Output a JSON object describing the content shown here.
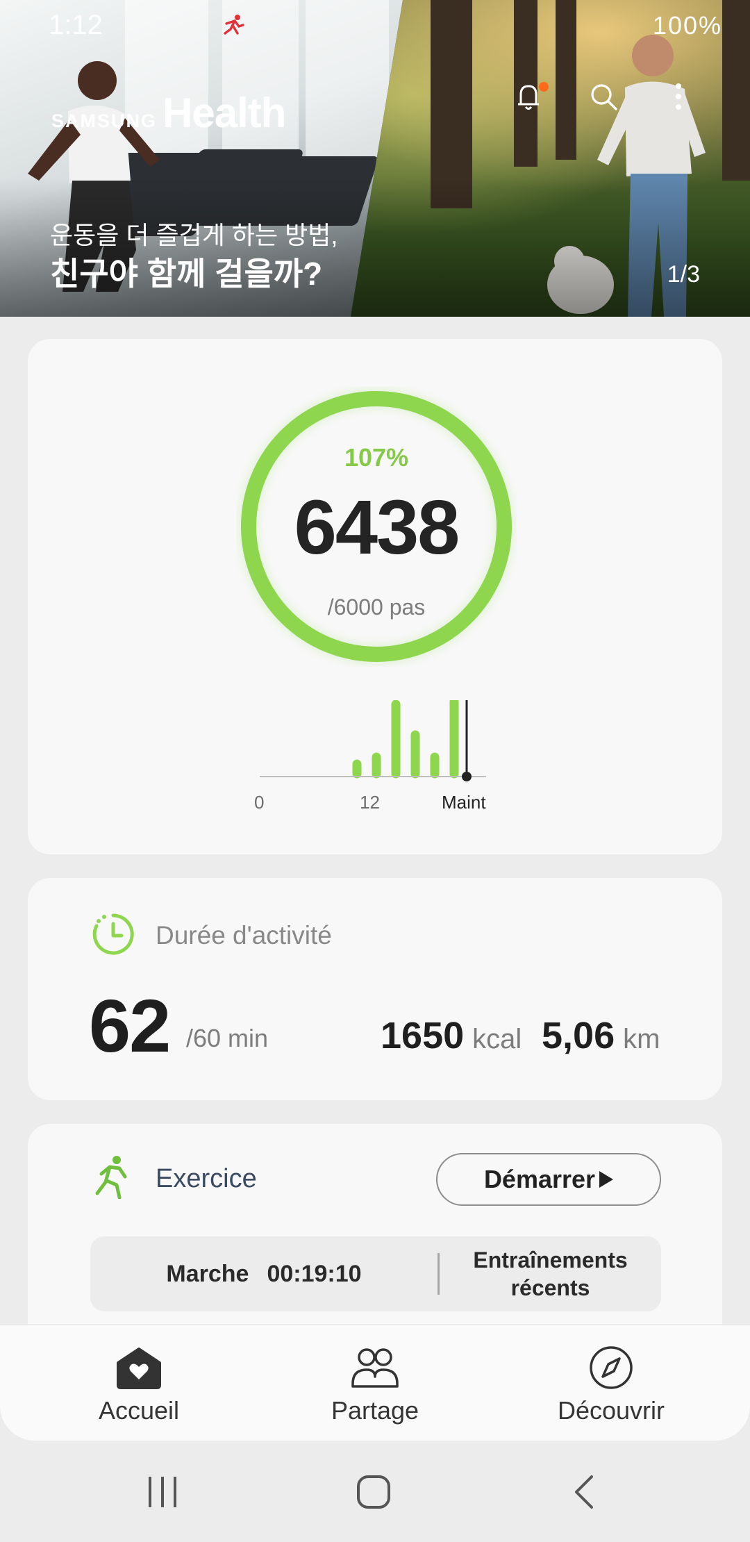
{
  "status_bar": {
    "time": "1:12",
    "app_icon": "runner-icon",
    "right": "100%",
    "icons": [
      "mute-icon",
      "volte-icon",
      "wifi-icon",
      "signal-icon",
      "battery-icon"
    ]
  },
  "hero": {
    "brand_samsung": "SAMSUNG",
    "brand_health": "Health",
    "subtitle": "운동을 더 즐겁게 하는 방법,",
    "title": "친구야 함께 걸을까?",
    "page_indicator": "1/3",
    "icons": [
      "notifications-icon",
      "search-icon",
      "more-icon"
    ]
  },
  "steps": {
    "percent": "107%",
    "count": "6438",
    "goal": "/6000 pas",
    "progress": 1.07,
    "chart_labels": [
      "0",
      "12",
      "Maint"
    ],
    "chart_bars": [
      0.14,
      0.24,
      1.0,
      0.56,
      0.24,
      1.04
    ]
  },
  "activity": {
    "title": "Durée d'activité",
    "minutes": "62",
    "minutes_goal": "/60 min",
    "kcal_value": "1650",
    "kcal_unit": "kcal",
    "distance_value": "5,06",
    "distance_unit": "km"
  },
  "exercise": {
    "title": "Exercice",
    "start_label": "Démarrer",
    "recent_type": "Marche",
    "recent_time": "00:19:10",
    "recent_workouts_line1": "Entraînements",
    "recent_workouts_line2": "récents"
  },
  "bottom_nav": {
    "items": [
      {
        "label": "Accueil",
        "icon": "home-icon"
      },
      {
        "label": "Partage",
        "icon": "people-icon"
      },
      {
        "label": "Découvrir",
        "icon": "compass-icon"
      }
    ]
  },
  "colors": {
    "accent_green": "#8ed64e",
    "alert_orange": "#ff6a1a"
  }
}
